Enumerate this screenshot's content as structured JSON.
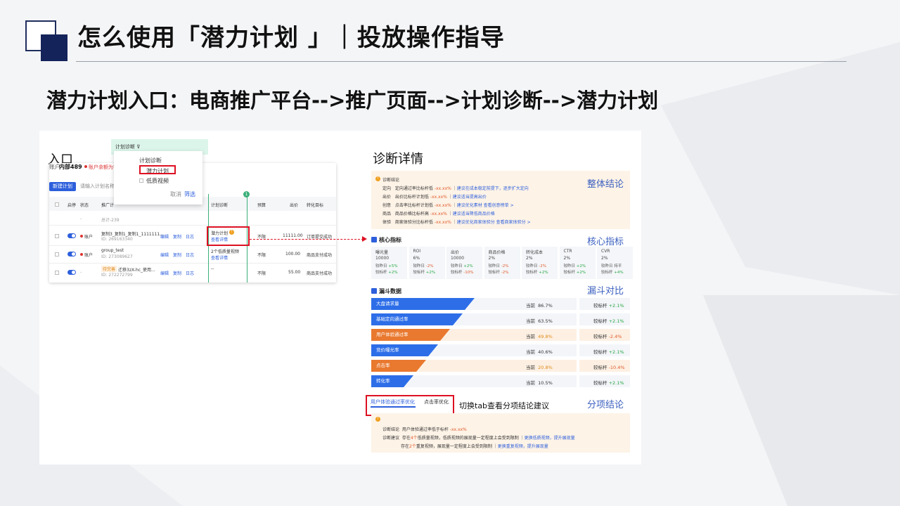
{
  "slide": {
    "title": "怎么使用「潜力计划 」｜投放操作指导",
    "subtitle": "潜力计划入口：电商推广平台-->推广页面-->计划诊断-->潜力计划"
  },
  "left": {
    "entry_title": "入口",
    "account_label": "账户",
    "account_value": "内部489",
    "account_warning": "账户余额为零",
    "new_plan_btn": "新建计划",
    "search_placeholder": "请输入计划名称",
    "columns": [
      "启停",
      "状态",
      "推广计",
      "计划诊断",
      "预算",
      "出价",
      "转化目标"
    ],
    "total_label": "总计-239",
    "dash": "-",
    "actions": [
      "编辑",
      "复制",
      "日志"
    ],
    "rows": [
      {
        "status": "账户",
        "name": "复制3_复制1_复制1_1111111...",
        "id": "ID: 269163340",
        "diag_title": "潜力计划",
        "diag_link": "查看详情",
        "budget": "不限",
        "bid": "11111.00",
        "goal": "订单提交成功"
      },
      {
        "status": "账户",
        "name": "group_test",
        "id": "ID: 273089627",
        "diag_title": "2个低质量视频",
        "diag_link": "查看详情",
        "budget": "不限",
        "bid": "100.00",
        "goal": "商品支付成功"
      },
      {
        "status": "",
        "tag": "待完善",
        "name": "迁移3zX-hc_使用...",
        "id": "ID: 272272799",
        "diag_title": "--",
        "diag_link": "",
        "budget": "不限",
        "bid": "55.00",
        "goal": "商品支付成功"
      }
    ],
    "column_badge": "1",
    "dropdown": {
      "header": "计划诊断 ⊽",
      "group_label": "计划诊断",
      "item_selected": "潜力计划",
      "item_other": "低质视频",
      "cancel": "取消",
      "filter": "筛选"
    }
  },
  "right": {
    "title": "诊断详情",
    "overall_label": "整体结论",
    "conclusion_title": "诊断结论",
    "conclusions": [
      {
        "k": "定向",
        "t": "定向通过率比标杆低",
        "v": "-xx.xx%",
        "a": "建议在成本稳定前提下，逐步扩大定向"
      },
      {
        "k": "出价",
        "t": "出价比标杆计划低",
        "v": "-xx.xx%",
        "a": "建议适当提高出价"
      },
      {
        "k": "创意",
        "t": "点击率比标杆计划低",
        "v": "-xx.xx%",
        "a": "建议优化素材  查看创意榜单 >"
      },
      {
        "k": "商品",
        "t": "商品价格比标杆高",
        "v": "-xx.xx%",
        "a": "建议适当降低商品价格"
      },
      {
        "k": "体验",
        "t": "商家体验分比标杆低",
        "v": "-xx.xx%",
        "a": "建议优化商家体验分  查看商家体验分 >"
      }
    ],
    "core_label": "核心指标",
    "core_head": "核心指标",
    "metrics": [
      {
        "name": "曝光量",
        "value": "10000",
        "l1": "较昨日",
        "v1": "+5%",
        "d1": "up",
        "l2": "较标杆",
        "v2": "+2%",
        "d2": "up"
      },
      {
        "name": "ROI",
        "value": "6%",
        "l1": "较昨日",
        "v1": "-2%",
        "d1": "down",
        "l2": "较标杆",
        "v2": "+2%",
        "d2": "up"
      },
      {
        "name": "出价",
        "value": "10000",
        "l1": "较昨日",
        "v1": "+2%",
        "d1": "up",
        "l2": "较标杆",
        "v2": "-10%",
        "d2": "down"
      },
      {
        "name": "商品价格",
        "value": "2%",
        "l1": "较昨日",
        "v1": "-2%",
        "d1": "down",
        "l2": "较标杆",
        "v2": "-2%",
        "d2": "down"
      },
      {
        "name": "转化成本",
        "value": "2%",
        "l1": "较昨日",
        "v1": "-2%",
        "d1": "down",
        "l2": "较标杆",
        "v2": "+2%",
        "d2": "up"
      },
      {
        "name": "CTR",
        "value": "2%",
        "l1": "较昨日",
        "v1": "+2%",
        "d1": "up",
        "l2": "较标杆",
        "v2": "+2%",
        "d2": "up"
      },
      {
        "name": "CVR",
        "value": "2%",
        "l1": "较昨日",
        "v1": "持平",
        "d1": "flat",
        "l2": "较标杆",
        "v2": "+4%",
        "d2": "up"
      }
    ],
    "funnel_label": "漏斗对比",
    "funnel_head": "漏斗数据",
    "funnel": [
      {
        "name": "大盘请求量",
        "cur_label": "当前",
        "cur": "86.7%",
        "bench_label": "较标杆",
        "bench": "+2.1%",
        "warn": false,
        "width": 0.68
      },
      {
        "name": "基础定向通过率",
        "cur_label": "当前",
        "cur": "63.5%",
        "bench_label": "较标杆",
        "bench": "+2.1%",
        "warn": false,
        "width": 0.6
      },
      {
        "name": "用户体验通过率",
        "cur_label": "当前",
        "cur": "49.8%",
        "bench_label": "较标杆",
        "bench": "-2.4%",
        "warn": true,
        "width": 0.52
      },
      {
        "name": "竞价曝光率",
        "cur_label": "当前",
        "cur": "40.6%",
        "bench_label": "较标杆",
        "bench": "+2.1%",
        "warn": false,
        "width": 0.44
      },
      {
        "name": "点击率",
        "cur_label": "当前",
        "cur": "20.8%",
        "bench_label": "较标杆",
        "bench": "-10.4%",
        "warn": true,
        "width": 0.36
      },
      {
        "name": "转化率",
        "cur_label": "当前",
        "cur": "10.5%",
        "bench_label": "较标杆",
        "bench": "+2.1%",
        "warn": false,
        "width": 0.28
      }
    ],
    "tabs": [
      "用户体验通过率优化",
      "点击率优化"
    ],
    "tab_note": "切换tab查看分项结论建议",
    "sub_label": "分项结论",
    "sub": {
      "c_label": "诊断结论",
      "c_text": "用户体验通过率低于标杆",
      "c_val": "-xx.xx%",
      "s_label": "诊断建议",
      "s1a": "存在",
      "s1n": "4个",
      "s1b": "低质量视频，低质视频的展现量一定程度上会受到限制",
      "s1link": "更换低质视频，提升展现量",
      "s2a": "存在",
      "s2n": "2个",
      "s2b": "重复视频，展现量一定程度上会受到限制",
      "s2link": "更换重复视频，提升展现量"
    }
  },
  "colors": {
    "accent": "#2d5fdc",
    "highlight": "#d12",
    "warn": "#e08a1a",
    "navy": "#14235a"
  }
}
